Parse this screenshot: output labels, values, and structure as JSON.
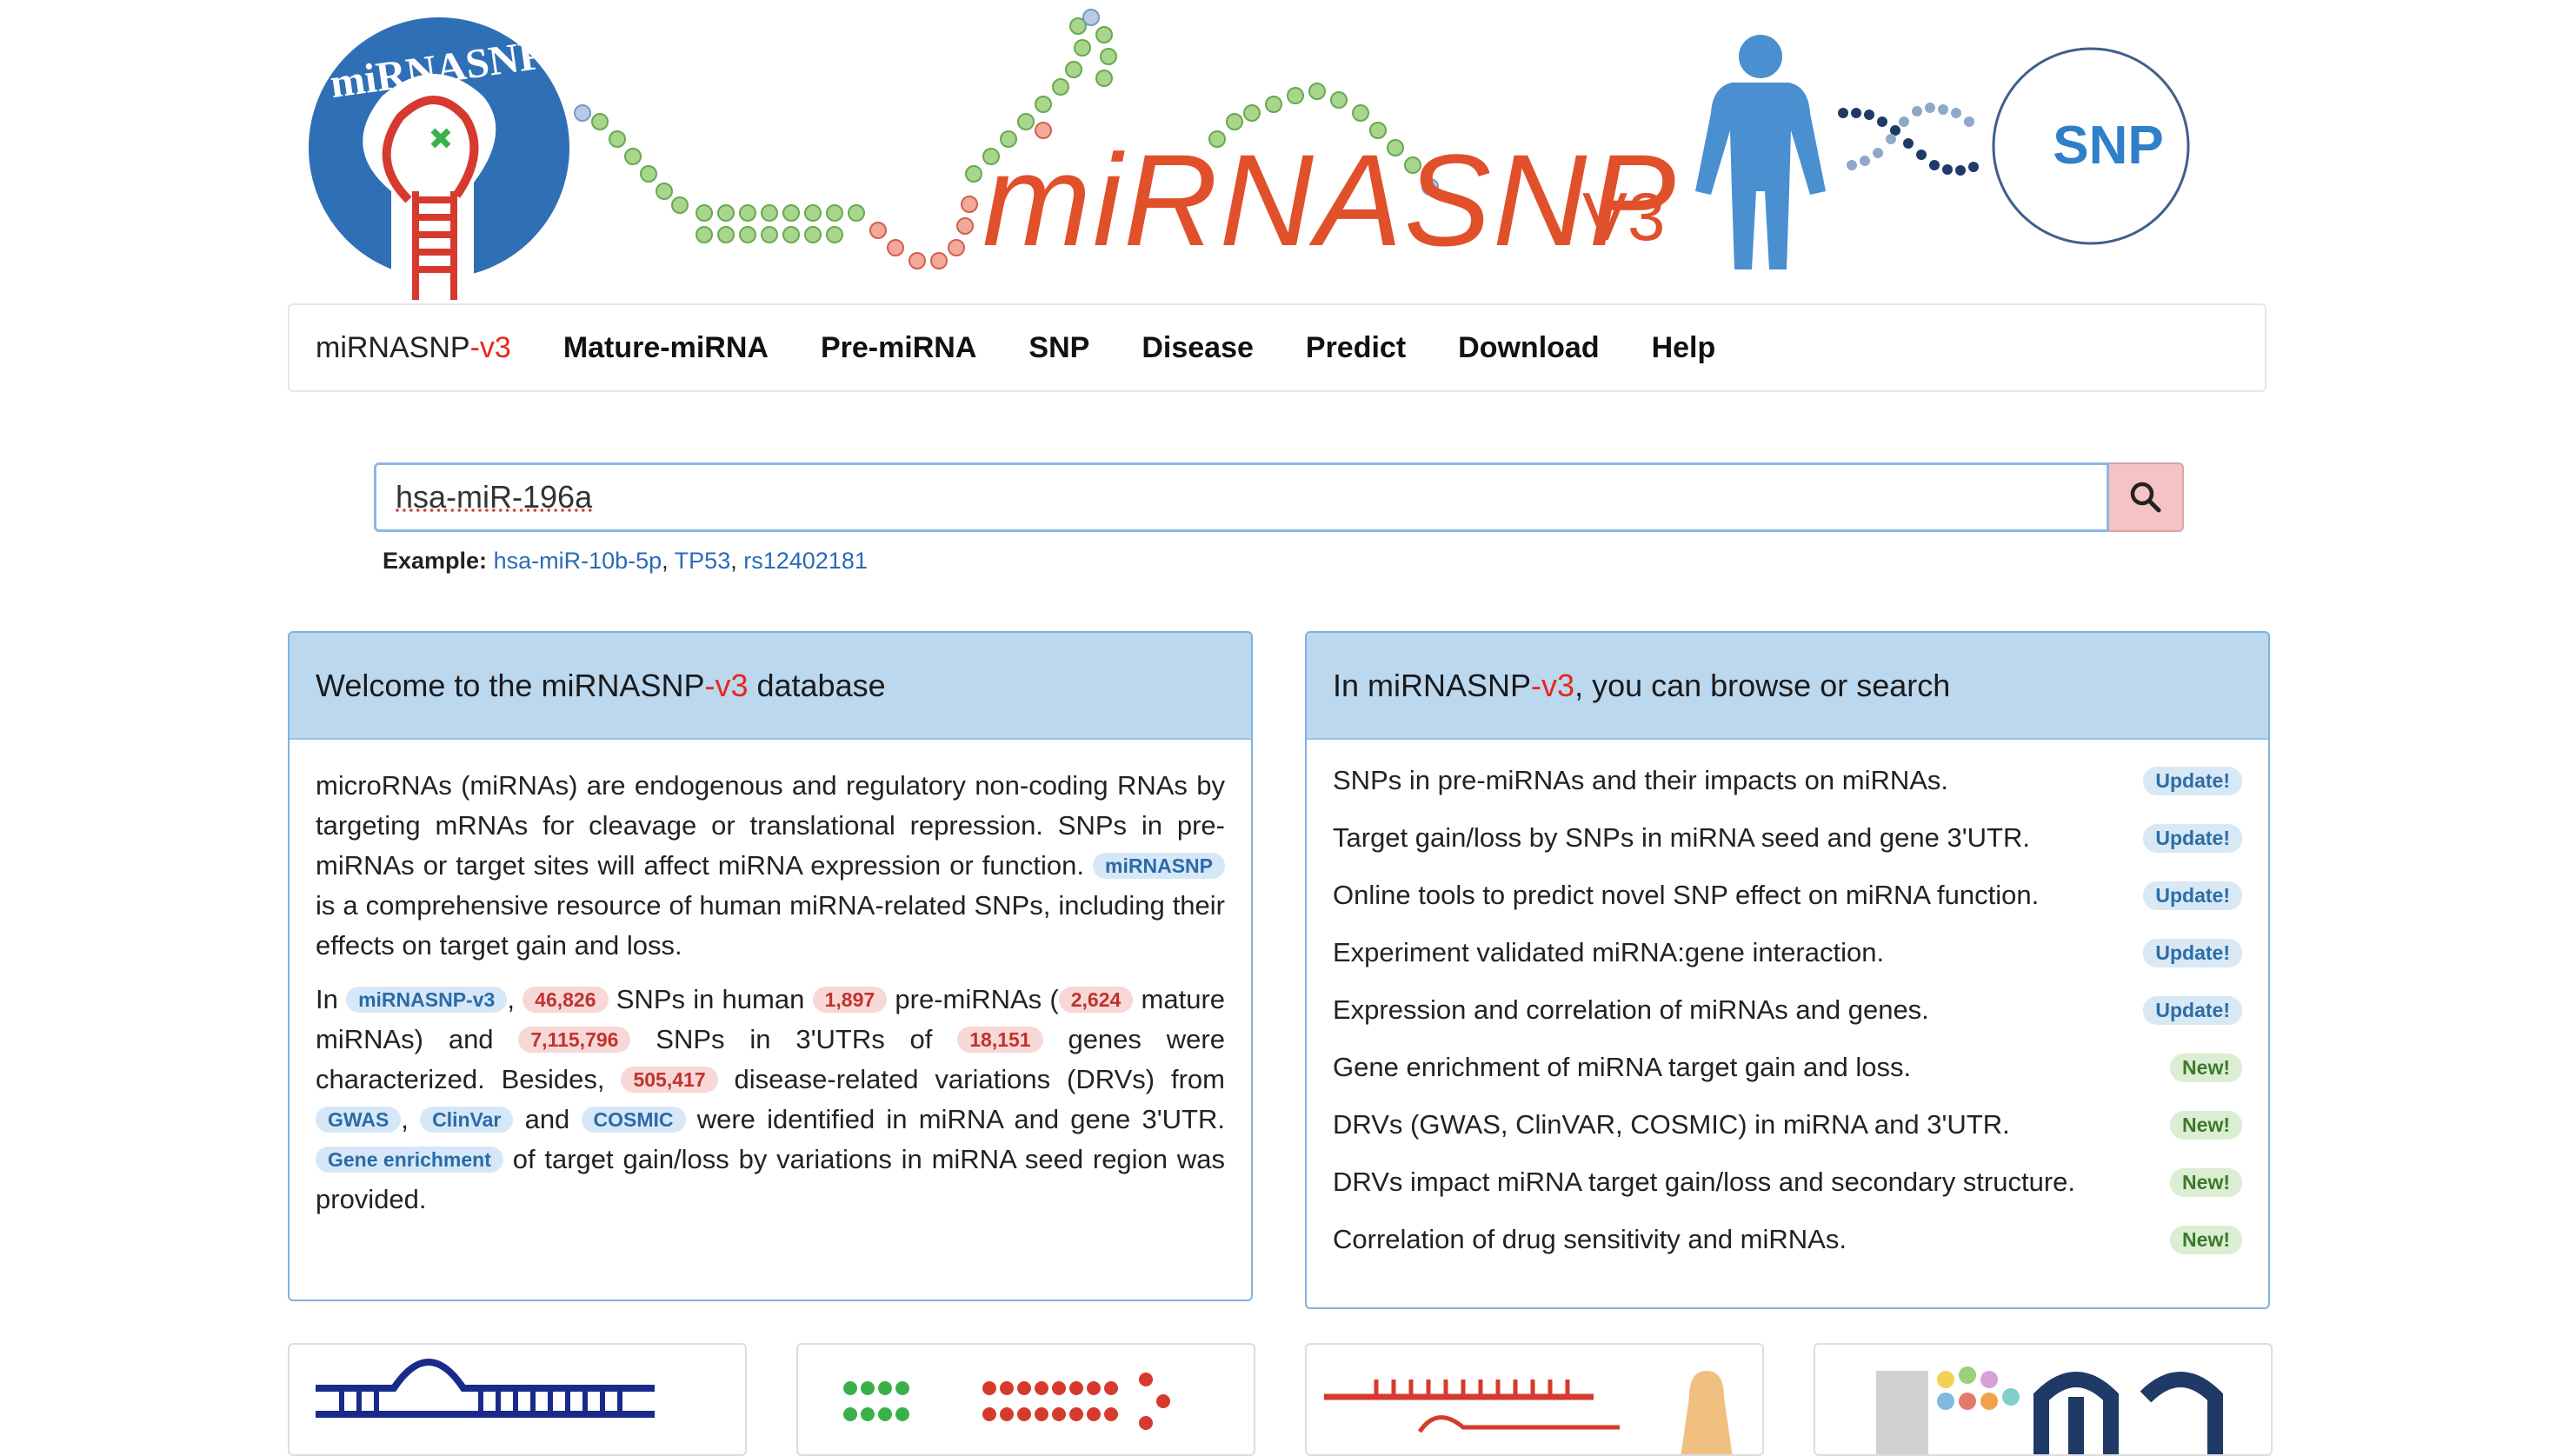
{
  "banner": {
    "logo_circle_text": "miRNASNP",
    "title": "miRNASNP",
    "version": "V3",
    "snp_label": "SNP",
    "colors": {
      "brand_orange": "#e0502b",
      "logo_blue": "#2f6fb5",
      "human_blue": "#4a8fd0"
    }
  },
  "nav": {
    "brand_prefix": "miRNASNP",
    "brand_suffix": "-v3",
    "items": [
      "Mature-miRNA",
      "Pre-miRNA",
      "SNP",
      "Disease",
      "Predict",
      "Download",
      "Help"
    ]
  },
  "search": {
    "value": "hsa-miR-196a",
    "example_label": "Example:",
    "examples": [
      "hsa-miR-10b-5p",
      "TP53",
      "rs12402181"
    ]
  },
  "welcome": {
    "title_prefix": "Welcome to the miRNASNP",
    "title_red": "-v3",
    "title_suffix": " database",
    "p1_text": "microRNAs (miRNAs) are endogenous and regulatory non-coding RNAs by targeting mRNAs for cleavage or translational repression. SNPs in pre-miRNAs or target sites will affect miRNA expression or function.",
    "p1_chip": "miRNASNP",
    "p1_tail": "is a comprehensive resource of human miRNA-related SNPs, including their effects on target gain and loss.",
    "p2": {
      "in": "In",
      "chip_db": "miRNASNP-v3",
      "snp_count": "46,826",
      "t1": "SNPs in human",
      "pre_count": "1,897",
      "t2": "pre-miRNAs (",
      "mature_count": "2,624",
      "t3": "mature miRNAs) and",
      "utr_snps": "7,115,796",
      "t4": "SNPs in 3'UTRs of",
      "gene_count": "18,151",
      "t5": "genes were characterized. Besides,",
      "drv_count": "505,417",
      "t6": "disease-related variations (DRVs) from",
      "gwas": "GWAS",
      "clinvar": "ClinVar",
      "and": "and",
      "cosmic": "COSMIC",
      "t7": "were identified in miRNA and gene 3'UTR.",
      "gene_enrich": "Gene enrichment",
      "t8": "of target gain/loss by variations in miRNA seed region was provided."
    }
  },
  "browse": {
    "title_prefix": "In miRNASNP",
    "title_red": "-v3",
    "title_suffix": ", you can browse or search",
    "features": [
      {
        "text": "SNPs in pre-miRNAs and their impacts on miRNAs.",
        "badge": "Update!",
        "kind": "update"
      },
      {
        "text": "Target gain/loss by SNPs in miRNA seed and gene 3'UTR.",
        "badge": "Update!",
        "kind": "update"
      },
      {
        "text": "Online tools to predict novel SNP effect on miRNA function.",
        "badge": "Update!",
        "kind": "update"
      },
      {
        "text": "Experiment validated miRNA:gene interaction.",
        "badge": "Update!",
        "kind": "update"
      },
      {
        "text": "Expression and correlation of miRNAs and genes.",
        "badge": "Update!",
        "kind": "update"
      },
      {
        "text": "Gene enrichment of miRNA target gain and loss.",
        "badge": "New!",
        "kind": "new"
      },
      {
        "text": "DRVs (GWAS, ClinVAR, COSMIC) in miRNA and 3'UTR.",
        "badge": "New!",
        "kind": "new"
      },
      {
        "text": "DRVs impact miRNA target gain/loss and secondary structure.",
        "badge": "New!",
        "kind": "new"
      },
      {
        "text": "Correlation of drug sensitivity and miRNAs.",
        "badge": "New!",
        "kind": "new"
      }
    ]
  }
}
